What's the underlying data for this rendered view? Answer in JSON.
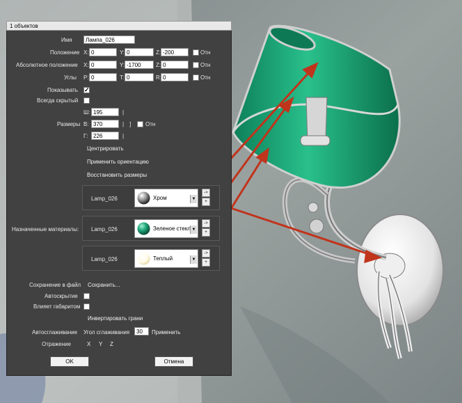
{
  "window": {
    "title": "1 объектов"
  },
  "name": {
    "label": "Имя",
    "value": "Лампа_026"
  },
  "position": {
    "label": "Положение",
    "x": "0",
    "y": "0",
    "z": "-200",
    "relative": "Отн"
  },
  "abs_position": {
    "label": "Абсолютное положение",
    "x": "0",
    "y": "-1700",
    "z": "0",
    "relative": "Отн"
  },
  "angles": {
    "label": "Углы",
    "p": "0",
    "t": "0",
    "r": "0",
    "relative": "Отн"
  },
  "axis": {
    "x": "X:",
    "y": "Y:",
    "z": "Z:",
    "p": "P:",
    "t": "T:",
    "r": "R:"
  },
  "show": {
    "label": "Показывать",
    "checked": true
  },
  "always_hidden": {
    "label": "Всегда скрытый",
    "checked": false
  },
  "sizes": {
    "label": "Размеры",
    "w_label": "Ш:",
    "h_label": "В:",
    "d_label": "Г:",
    "w": "195",
    "h": "370",
    "d": "226",
    "relative": "Отн"
  },
  "actions": {
    "center": "Центрировать",
    "apply_orientation": "Применить ориентацию",
    "restore_sizes": "Восстановить размеры"
  },
  "materials": {
    "label": "Назначенные материалы:",
    "items": [
      {
        "object": "Lamp_026",
        "name": "Хром",
        "swatch": "#9a9a9a"
      },
      {
        "object": "Lamp_026",
        "name": "Зеленое стекл",
        "swatch": "#1fa67a"
      },
      {
        "object": "Lamp_026",
        "name": "Теплый",
        "swatch": "#fffbe8"
      }
    ],
    "pick_symbol": "->",
    "add_symbol": "+"
  },
  "save_file": {
    "label": "Сохранение в файл",
    "button": "Сохранить..."
  },
  "autohide": {
    "label": "Автоскрытие",
    "checked": false
  },
  "affects_bounds": {
    "label": "Влияет габаритом",
    "checked": false
  },
  "invert_faces": "Инвертировать грани",
  "autosmooth": {
    "label": "Автосглаживание",
    "angle_label": "Угол сглаживания",
    "angle": "30",
    "apply": "Применить"
  },
  "mirror": {
    "label": "Отражение",
    "x": "X",
    "y": "Y",
    "z": "Z"
  },
  "buttons": {
    "ok": "OK",
    "cancel": "Отмена"
  },
  "colors": {
    "panel": "#414141",
    "shade_green": "#1aa36f",
    "arrow": "#c0341c"
  }
}
